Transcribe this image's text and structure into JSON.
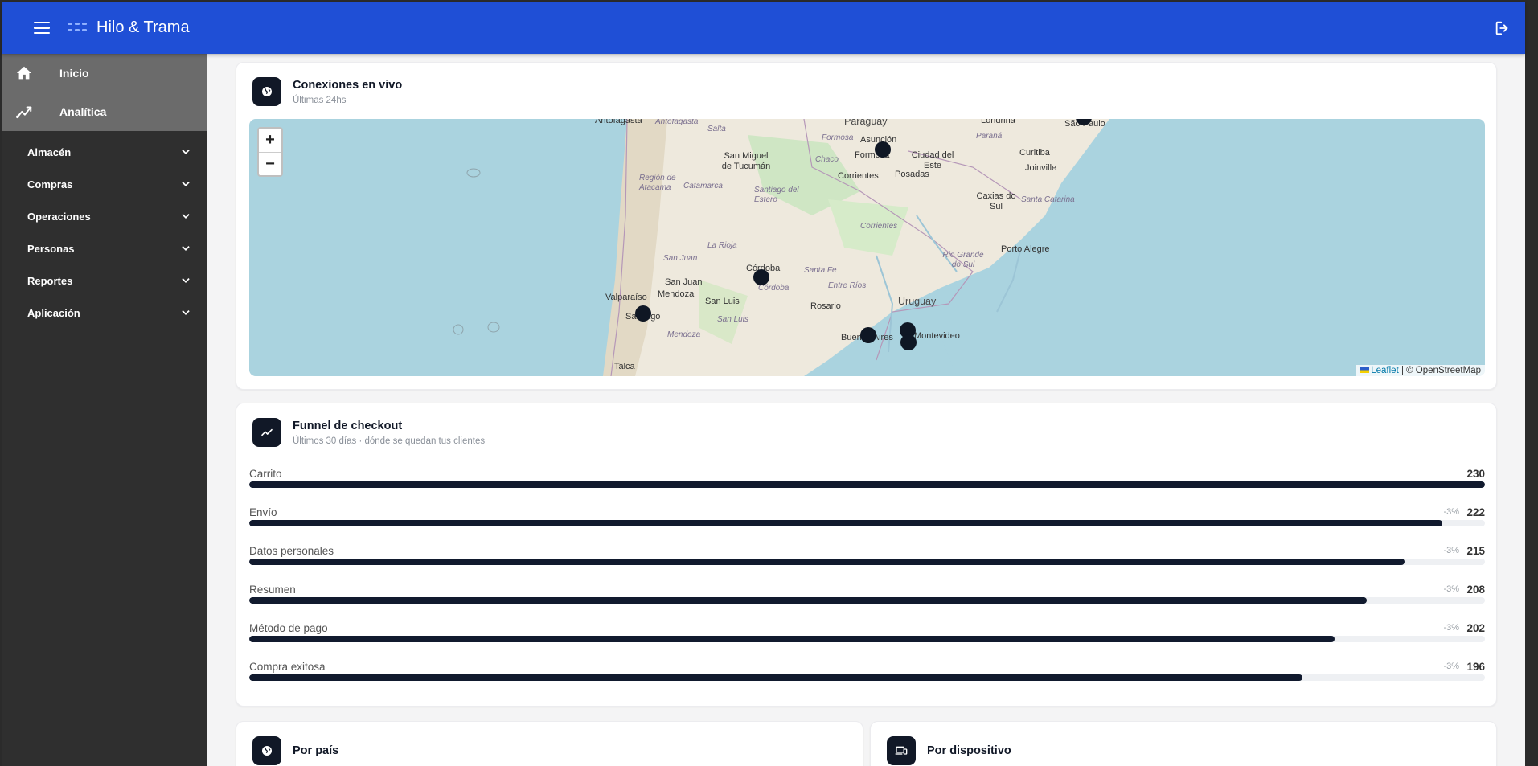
{
  "app": {
    "title": "Hilo & Trama",
    "colors": {
      "appbar": "#1f4fd6",
      "sidebar": "#2f2f2f",
      "accent_dark": "#111827"
    }
  },
  "sidebar": {
    "top_items": [
      {
        "label": "Inicio",
        "icon": "home-icon"
      },
      {
        "label": "Analítica",
        "icon": "analytics-icon"
      }
    ],
    "groups": [
      {
        "label": "Almacén"
      },
      {
        "label": "Compras"
      },
      {
        "label": "Operaciones"
      },
      {
        "label": "Personas"
      },
      {
        "label": "Reportes"
      },
      {
        "label": "Aplicación"
      }
    ]
  },
  "live": {
    "title": "Conexiones en vivo",
    "subtitle": "Últimas 24hs",
    "icon": "globe-icon",
    "map": {
      "zoom_in": "+",
      "zoom_out": "−",
      "attribution_link": "Leaflet",
      "attribution_rest": " | © OpenStreetMap",
      "places": [
        "Antofagasta",
        "Antofagasta",
        "Salta",
        "Paraguay",
        "Formosa",
        "Asunción",
        "Londrina",
        "São Paulo",
        "Paraná",
        "San Miguel de Tucumán",
        "Chaco",
        "Formosa",
        "Ciudad del Este",
        "Curitiba",
        "Región de Atacama",
        "Catamarca",
        "Santiago del Estero",
        "Corrientes",
        "Posadas",
        "Joinville",
        "Santa Catarina",
        "Caxias do Sul",
        "Corrientes",
        "La Rioja",
        "Rio Grande do Sul",
        "Porto Alegre",
        "San Juan",
        "Córdoba",
        "Santa Fe",
        "San Juan",
        "Córdoba",
        "Entre Ríos",
        "Mendoza",
        "Valparaíso",
        "San Luis",
        "Rosario",
        "Uruguay",
        "Santiago",
        "San Luis",
        "Mendoza",
        "Buenos Aires",
        "Montevideo",
        "Talca"
      ]
    }
  },
  "funnel": {
    "title": "Funnel de checkout",
    "subtitle": "Últimos 30 días · dónde se quedan tus clientes",
    "icon": "trend-icon",
    "steps": [
      {
        "label": "Carrito",
        "value": "230",
        "pct": "",
        "fraction": 1.0
      },
      {
        "label": "Envío",
        "value": "222",
        "pct": "-3%",
        "fraction": 0.9652
      },
      {
        "label": "Datos personales",
        "value": "215",
        "pct": "-3%",
        "fraction": 0.9348
      },
      {
        "label": "Resumen",
        "value": "208",
        "pct": "-3%",
        "fraction": 0.9043
      },
      {
        "label": "Método de pago",
        "value": "202",
        "pct": "-3%",
        "fraction": 0.8783
      },
      {
        "label": "Compra exitosa",
        "value": "196",
        "pct": "-3%",
        "fraction": 0.8522
      }
    ]
  },
  "country": {
    "title": "Por país",
    "icon": "globe-icon"
  },
  "device": {
    "title": "Por dispositivo",
    "icon": "devices-icon"
  }
}
